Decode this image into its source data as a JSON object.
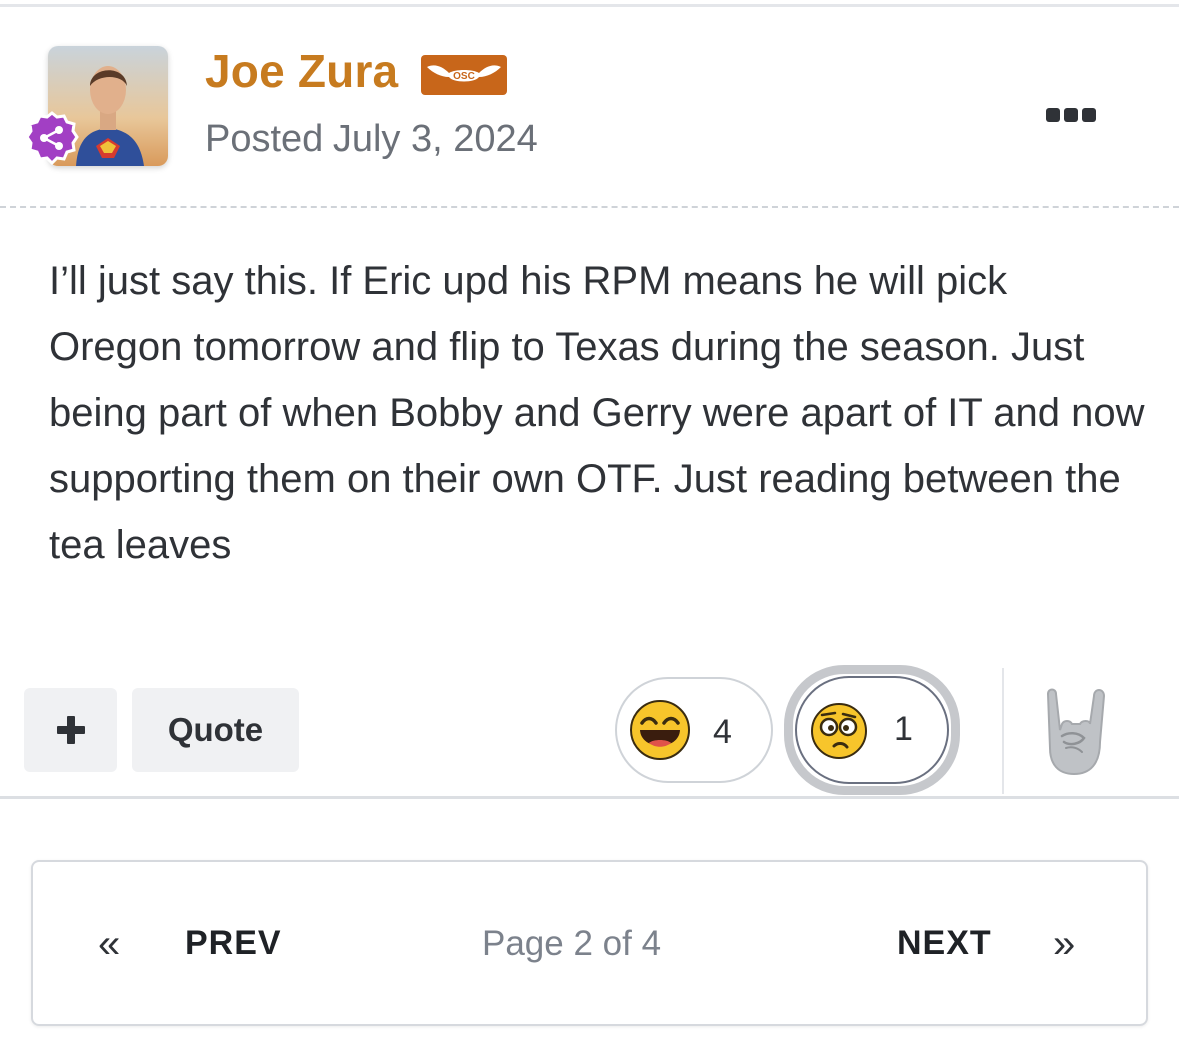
{
  "post": {
    "author": "Joe Zura",
    "rank_badge_text": "OSC",
    "posted_label": "Posted",
    "posted_date": "July 3, 2024",
    "content": "I’ll just say this. If Eric upd his RPM means he will pick Oregon tomorrow and flip to Texas during the season. Just being part of when Bobby and Gerry were apart of IT and now supporting them on their own OTF. Just reading between the tea leaves"
  },
  "actions": {
    "plus_label": "+",
    "quote_label": "Quote"
  },
  "reactions": [
    {
      "icon": "laughing-emoji-icon",
      "count": "4"
    },
    {
      "icon": "confused-emoji-icon",
      "count": "1"
    }
  ],
  "pagination": {
    "prev_label": "PREV",
    "status": "Page 2 of 4",
    "next_label": "NEXT"
  },
  "colors": {
    "author": "#c77b1f",
    "rank_badge": "#c8661a",
    "group_badge": "#a23fc4"
  }
}
